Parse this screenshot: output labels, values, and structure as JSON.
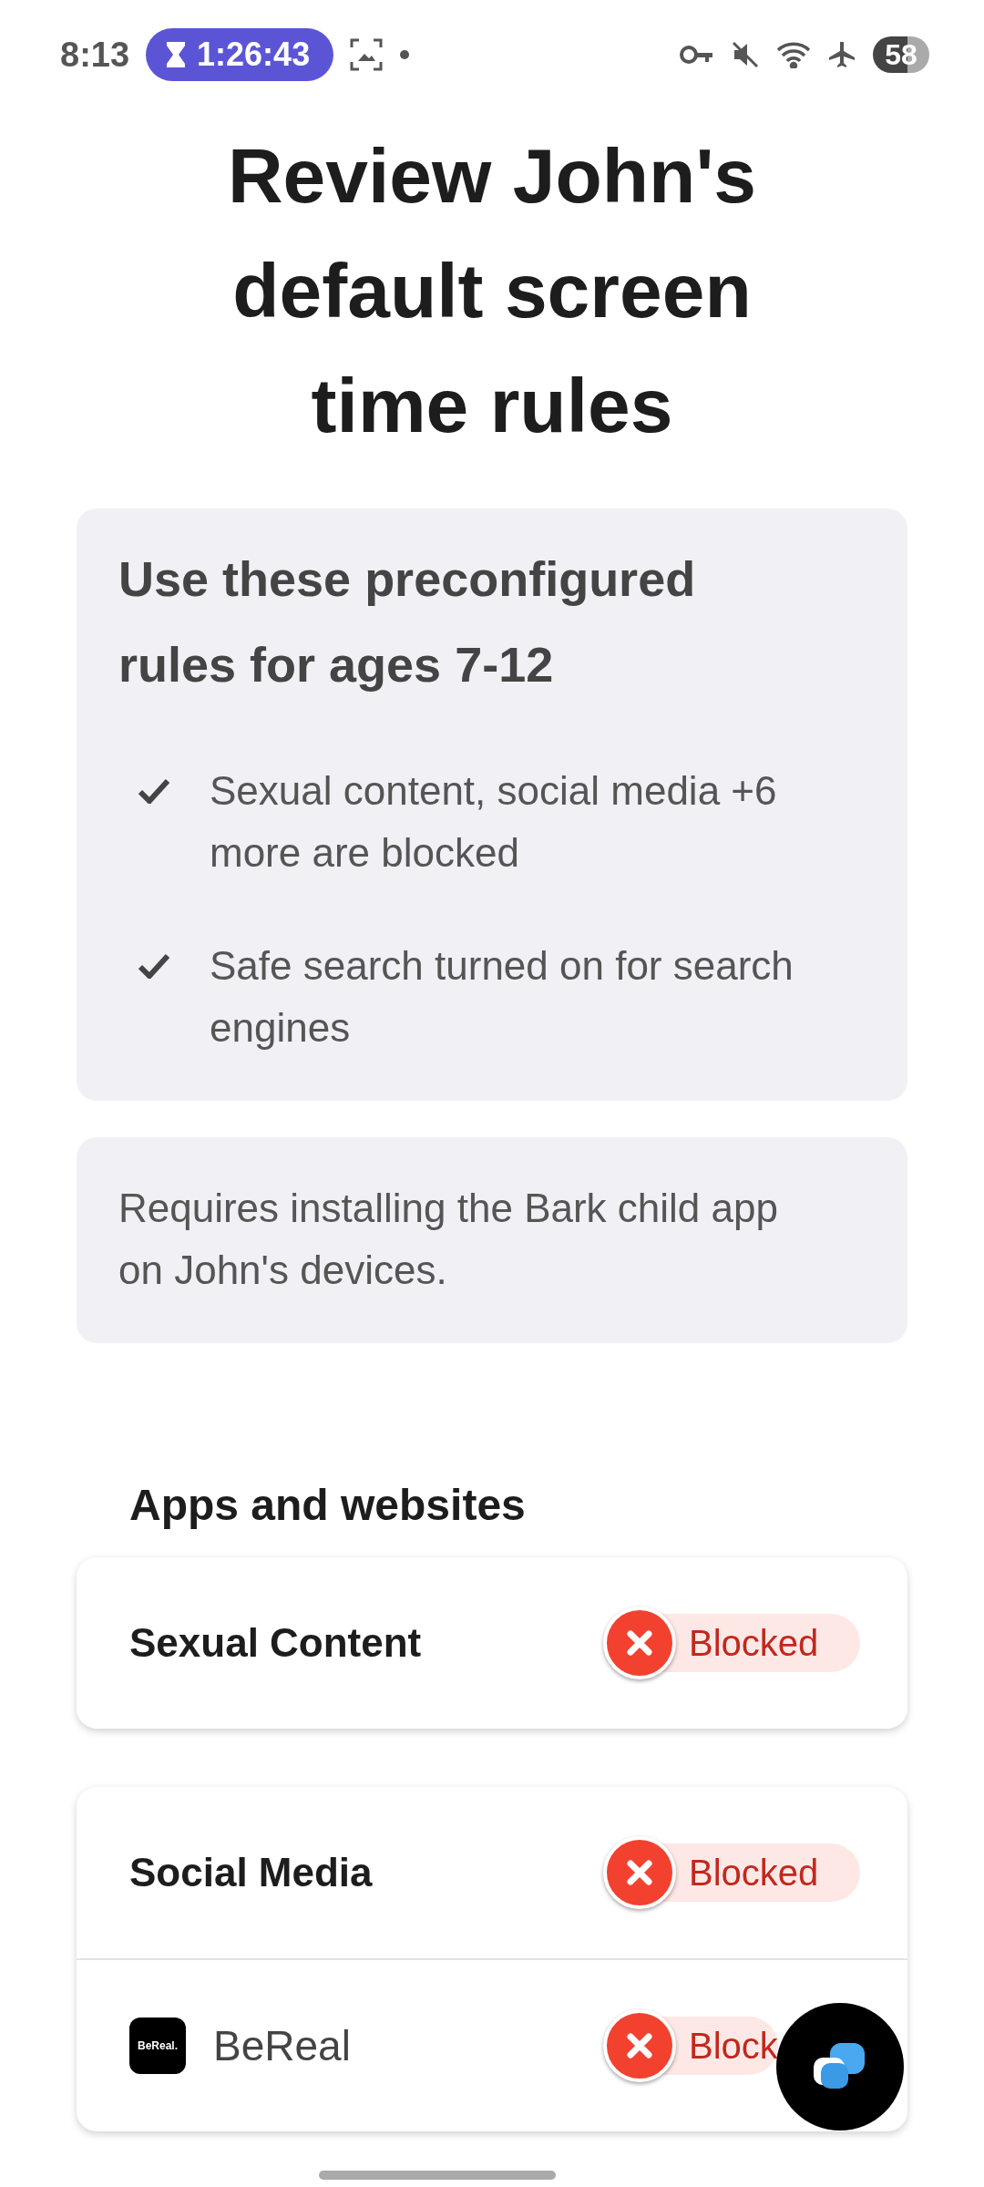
{
  "status_bar": {
    "time": "8:13",
    "timer": "1:26:43",
    "battery": "58"
  },
  "title": "Review John's default screen time rules",
  "preset_card": {
    "heading": "Use these preconfigured rules for ages 7-12",
    "bullets": [
      "Sexual content, social media +6 more are blocked",
      "Safe search turned on for search engines"
    ]
  },
  "note_card": {
    "text": "Requires installing the Bark child app on John's devices."
  },
  "section_title": "Apps and websites",
  "rule_groups": [
    {
      "rows": [
        {
          "kind": "category",
          "label": "Sexual Content",
          "status": "Blocked"
        }
      ]
    },
    {
      "rows": [
        {
          "kind": "category",
          "label": "Social Media",
          "status": "Blocked"
        },
        {
          "kind": "app",
          "label": "BeReal",
          "icon_text": "BeReal.",
          "status": "Block"
        }
      ]
    }
  ]
}
